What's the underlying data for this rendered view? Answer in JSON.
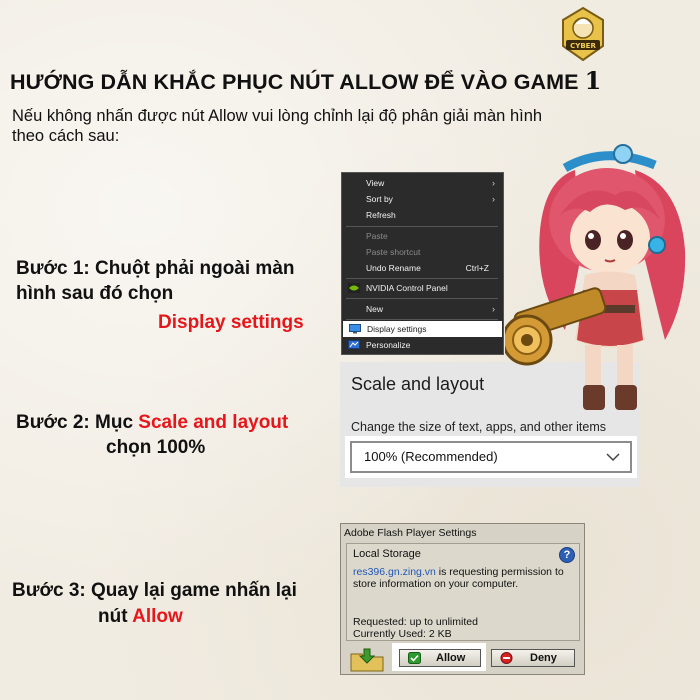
{
  "header": {
    "title": "HƯỚNG DẪN KHẮC PHỤC NÚT ALLOW ĐỂ VÀO GAME",
    "title_number": "1",
    "logo_text": "CYBER"
  },
  "intro": {
    "line1": "Nếu không nhấn được nút Allow vui lòng chỉnh lại độ phân giải màn hình",
    "line2": "theo cách sau:"
  },
  "steps": {
    "step1": {
      "line1": "Bước 1: Chuột phải ngoài màn",
      "line2": "hình sau đó chọn",
      "highlight": "Display settings"
    },
    "step2": {
      "prefix": "Bước 2: Mục ",
      "highlight": "Scale and layout",
      "line2": "chọn 100%"
    },
    "step3": {
      "line1": "Bước 3: Quay lại game nhấn lại",
      "prefix2": "nút ",
      "highlight": "Allow"
    }
  },
  "context_menu": {
    "items": [
      {
        "label": "View",
        "has_submenu": true
      },
      {
        "label": "Sort by",
        "has_submenu": true
      },
      {
        "label": "Refresh"
      },
      {
        "label": "Paste",
        "disabled": true
      },
      {
        "label": "Paste shortcut",
        "disabled": true
      },
      {
        "label": "Undo Rename",
        "shortcut": "Ctrl+Z"
      },
      {
        "label": "NVIDIA Control Panel"
      },
      {
        "label": "New",
        "has_submenu": true
      },
      {
        "label": "Display settings",
        "highlighted": true
      },
      {
        "label": "Personalize"
      }
    ]
  },
  "scale_panel": {
    "title": "Scale and layout",
    "subtitle": "Change the size of text, apps, and other items",
    "selected": "100% (Recommended)"
  },
  "flash_dialog": {
    "title": "Adobe Flash Player Settings",
    "section": "Local Storage",
    "site": "res396.gn.zing.vn",
    "message_after_site": " is requesting permission to store information on your computer.",
    "requested": "Requested: up to unlimited",
    "used": "Currently Used: 2 KB",
    "allow_label": "Allow",
    "deny_label": "Deny",
    "help_label": "?"
  },
  "colors": {
    "accent_red": "#e6161b",
    "menu_bg": "#2b2b2b",
    "panel_bg": "#e6e6e6",
    "flash_bg": "#d6d2c6",
    "link_blue": "#1f57b8"
  }
}
